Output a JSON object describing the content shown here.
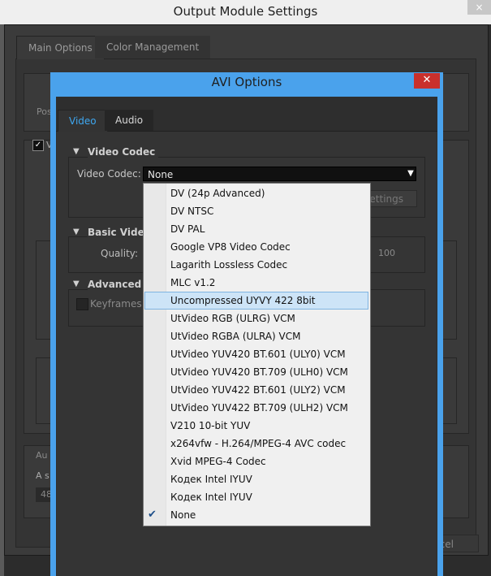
{
  "outer": {
    "title": "Output Module Settings",
    "close": "×",
    "tabs": [
      "Main Options",
      "Color Management"
    ],
    "ghost": {
      "pos": "Pos",
      "v": "V",
      "au": "Au",
      "as": "A s",
      "n48": "48",
      "cancel": "cel"
    }
  },
  "avi": {
    "title": "AVI Options",
    "close": "✕",
    "tabs": [
      "Video",
      "Audio"
    ],
    "video_codec_section": "Video Codec",
    "video_codec_label": "Video Codec:",
    "video_codec_value": "None",
    "settings_button": "Settings",
    "basic_video_section": "Basic Video",
    "quality_label": "Quality:",
    "quality_value": "100",
    "advanced_section": "Advanced Se",
    "keyframes_label": "Keyframes"
  },
  "dropdown": {
    "options": [
      "DV (24p Advanced)",
      "DV NTSC",
      "DV PAL",
      "Google VP8 Video Codec",
      "Lagarith Lossless Codec",
      "MLC v1.2",
      "Uncompressed UYVY 422 8bit",
      "UtVideo RGB (ULRG) VCM",
      "UtVideo RGBA (ULRA) VCM",
      "UtVideo YUV420 BT.601 (ULY0) VCM",
      "UtVideo YUV420 BT.709 (ULH0) VCM",
      "UtVideo YUV422 BT.601 (ULY2) VCM",
      "UtVideo YUV422 BT.709 (ULH2) VCM",
      "V210 10-bit YUV",
      "x264vfw - H.264/MPEG-4 AVC codec",
      "Xvid MPEG-4 Codec",
      "Кодек Intel IYUV",
      "Кодек Intel IYUV",
      "None"
    ],
    "highlighted": "Uncompressed UYVY 422 8bit",
    "checked": "None"
  }
}
